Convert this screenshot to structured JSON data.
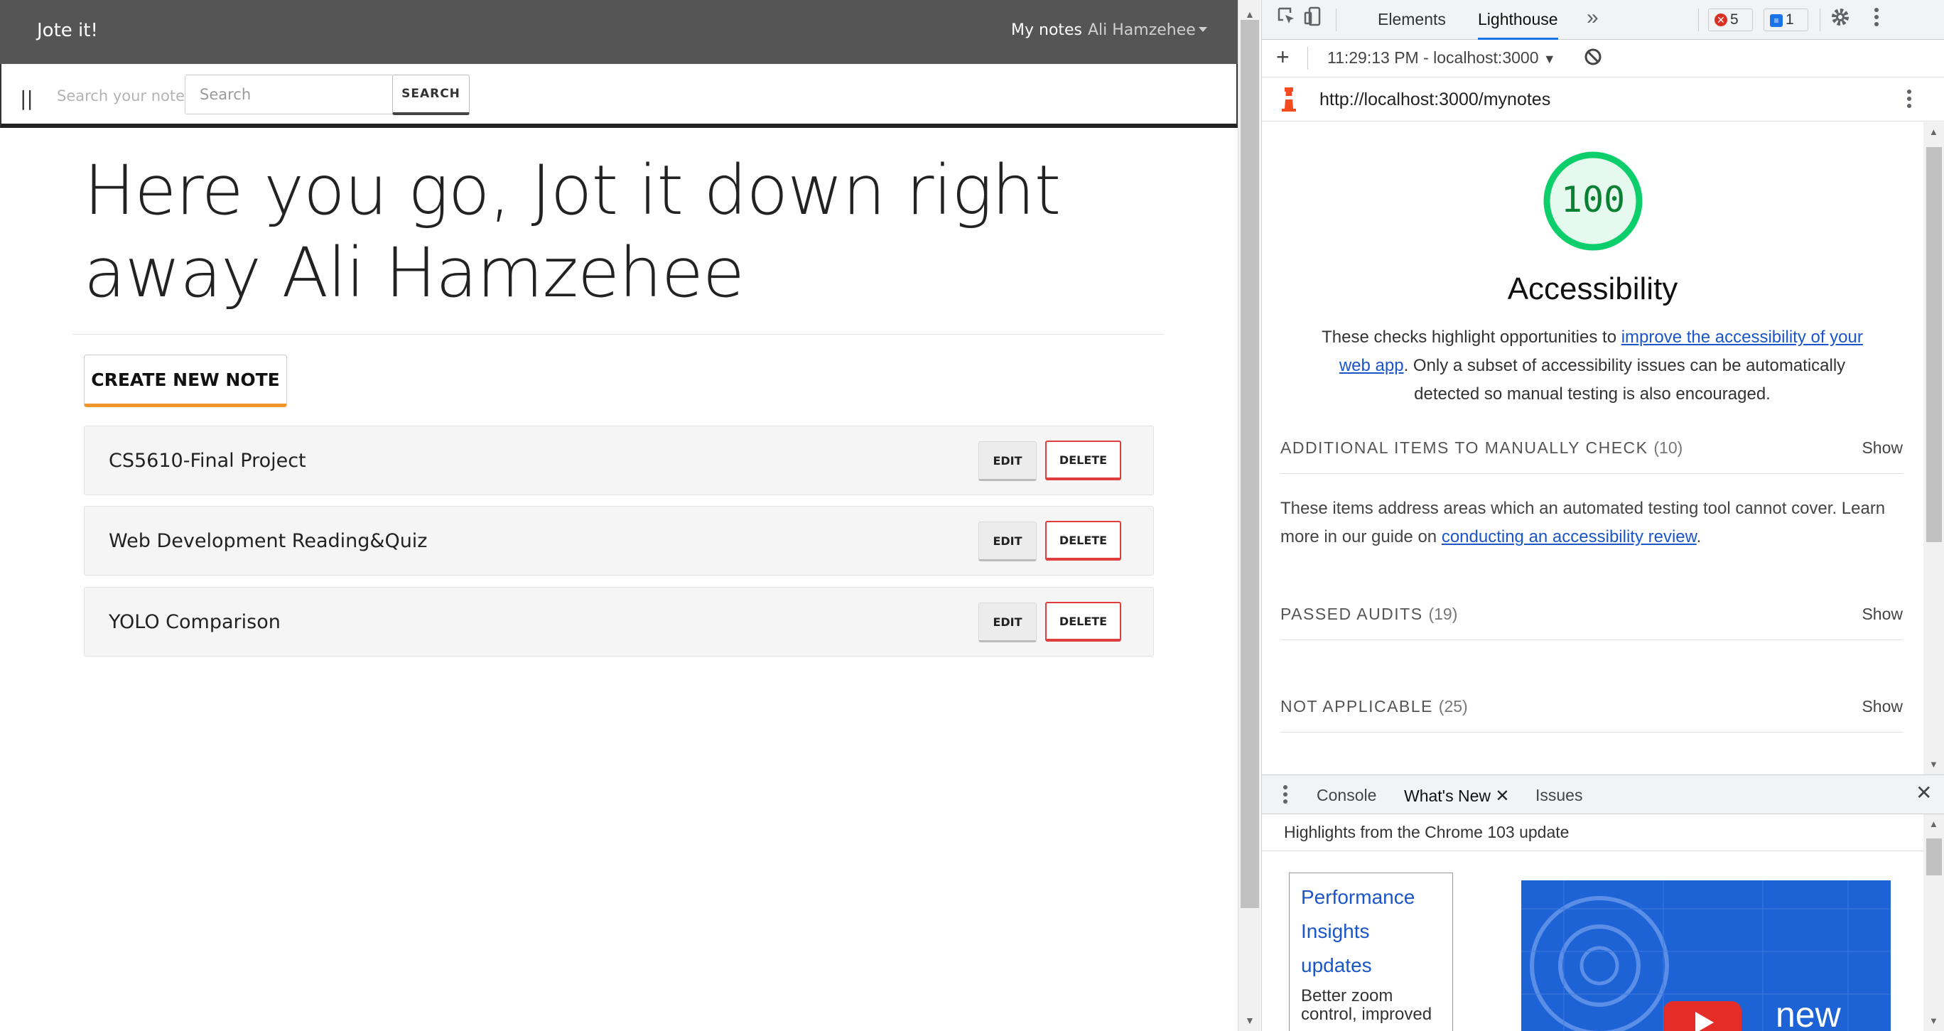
{
  "app": {
    "brand": "Jote it!",
    "nav": {
      "my_notes": "My notes",
      "user": "Ali Hamzehee"
    },
    "search": {
      "label": "Search your notes",
      "placeholder": "Search",
      "button": "SEARCH",
      "handle": "||"
    },
    "hero": "Here you go, Jot it down right away Ali Hamzehee",
    "create_button": "CREATE NEW NOTE",
    "notes": [
      {
        "title": "CS5610-Final Project",
        "edit": "EDIT",
        "delete": "DELETE"
      },
      {
        "title": "Web Development Reading&Quiz",
        "edit": "EDIT",
        "delete": "DELETE"
      },
      {
        "title": "YOLO Comparison",
        "edit": "EDIT",
        "delete": "DELETE"
      }
    ],
    "accent": "#f0952a",
    "danger": "#e03e3e"
  },
  "devtools": {
    "tabs": {
      "elements": "Elements",
      "lighthouse": "Lighthouse",
      "more": "»"
    },
    "errors_count": "5",
    "messages_count": "1",
    "report_selector": "11:29:13 PM - localhost:3000",
    "url": "http://localhost:3000/mynotes",
    "lighthouse": {
      "score": "100",
      "score_fraction": 1.0,
      "score_color": "#0cce6b",
      "category": "Accessibility",
      "desc_before": "These checks highlight opportunities to ",
      "desc_link": "improve the accessibility of your web app",
      "desc_after": ". Only a subset of accessibility issues can be automatically detected so manual testing is also encouraged.",
      "groups": [
        {
          "title": "Additional items to manually check",
          "count": "(10)",
          "show": "Show"
        },
        {
          "title": "Passed audits",
          "count": "(19)",
          "show": "Show"
        },
        {
          "title": "Not applicable",
          "count": "(25)",
          "show": "Show"
        }
      ],
      "manual_desc_before": "These items address areas which an automated testing tool cannot cover. Learn more in our guide on ",
      "manual_desc_link": "conducting an accessibility review",
      "manual_desc_after": "."
    },
    "drawer": {
      "tabs": {
        "console": "Console",
        "whats_new": "What's New",
        "issues": "Issues"
      },
      "header": "Highlights from the Chrome 103 update",
      "card_link": "Performance Insights updates",
      "card_sub": "Better zoom control, improved",
      "video_label": "new"
    }
  }
}
